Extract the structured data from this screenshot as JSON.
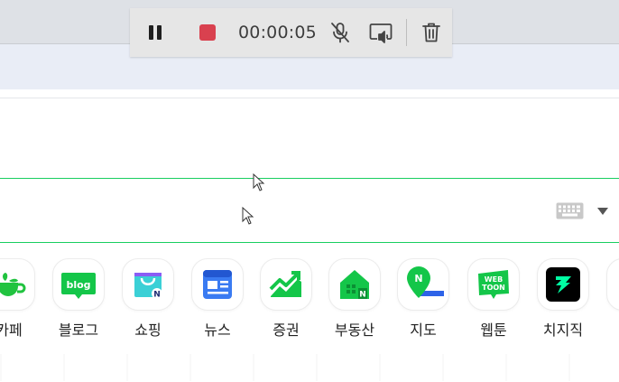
{
  "recorder": {
    "timer": "00:00:05",
    "icons": [
      "pause-icon",
      "stop-icon",
      "mic-muted-icon",
      "screen-cast-icon",
      "trash-icon"
    ],
    "stop_color": "#d9414f"
  },
  "search": {
    "value": "",
    "accent": "#19ce60"
  },
  "shortcuts": [
    {
      "label": "카페",
      "icon": "cafe-icon"
    },
    {
      "label": "블로그",
      "icon": "blog-icon",
      "tile_text": "blog"
    },
    {
      "label": "쇼핑",
      "icon": "shopping-bag-icon",
      "badge": "N"
    },
    {
      "label": "뉴스",
      "icon": "news-icon"
    },
    {
      "label": "증권",
      "icon": "stock-chart-icon"
    },
    {
      "label": "부동산",
      "icon": "real-estate-icon",
      "badge": "N"
    },
    {
      "label": "지도",
      "icon": "map-pin-icon",
      "badge": "N"
    },
    {
      "label": "웹툰",
      "icon": "webtoon-icon",
      "tile_text_1": "WEB",
      "tile_text_2": "TOON"
    },
    {
      "label": "치지직",
      "icon": "chzzk-icon"
    }
  ]
}
